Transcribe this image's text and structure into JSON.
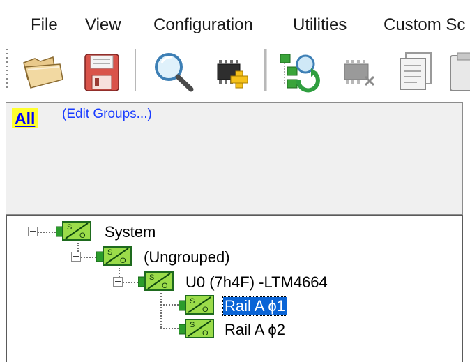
{
  "menu": {
    "items": [
      {
        "label": "File"
      },
      {
        "label": "View"
      },
      {
        "label": "Configuration"
      },
      {
        "label": "Utilities"
      },
      {
        "label": "Custom Sc"
      }
    ]
  },
  "toolbar": {
    "buttons": [
      {
        "icon": "open-folder-icon"
      },
      {
        "icon": "save-floppy-icon"
      },
      {
        "icon": "magnifier-search-icon"
      },
      {
        "icon": "add-device-icon"
      },
      {
        "icon": "rescan-tree-icon"
      },
      {
        "icon": "remove-device-icon"
      },
      {
        "icon": "copy-document-icon"
      },
      {
        "icon": "paste-clipboard-icon"
      }
    ]
  },
  "groups": {
    "all_label": "All",
    "edit_link": "(Edit Groups...)"
  },
  "tree": {
    "nodes": [
      {
        "label": "System",
        "icon": "power-module-icon",
        "selected": false
      },
      {
        "label": "(Ungrouped)",
        "icon": "power-module-icon",
        "selected": false
      },
      {
        "label": "U0 (7h4F) -LTM4664",
        "icon": "power-module-icon",
        "selected": false
      },
      {
        "label": "Rail A ϕ1",
        "icon": "power-module-icon",
        "selected": true
      },
      {
        "label": "Rail A ϕ2",
        "icon": "power-module-icon",
        "selected": false
      }
    ]
  },
  "colors": {
    "selection": "#0a64d6",
    "all_tag_bg": "#ffff2e",
    "link": "#1a3cff",
    "module_green": "#2fa52f",
    "module_label_green": "#9bdc4a"
  }
}
